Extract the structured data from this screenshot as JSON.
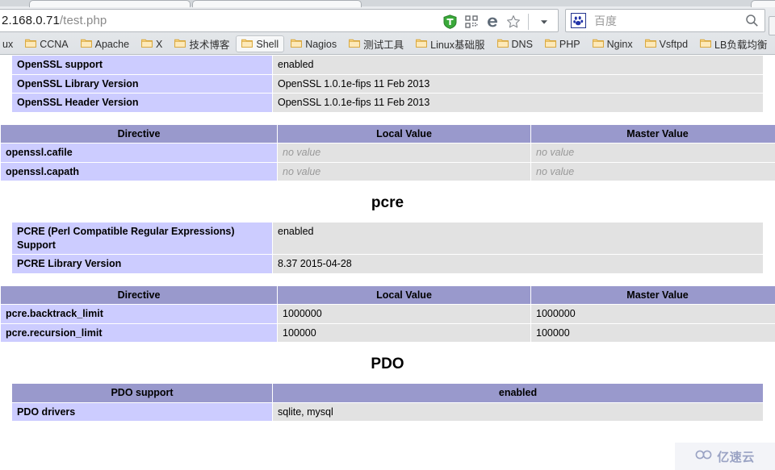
{
  "browser": {
    "url_host": "2.168.0.71",
    "url_path": "/test.php",
    "icons": {
      "shield": "shield-icon",
      "qrcode": "qrcode-icon",
      "ie_mode": "ie-compatibility-icon",
      "favorite": "star-icon",
      "dropdown": "chevron-down-icon",
      "search_submit": "search-icon",
      "baidu": "baidu-paw-icon"
    },
    "search": {
      "placeholder": "百度"
    },
    "bookmarks": [
      {
        "label": "ux",
        "active": false,
        "clipped": true
      },
      {
        "label": "CCNA",
        "active": false
      },
      {
        "label": "Apache",
        "active": false
      },
      {
        "label": "X",
        "active": false
      },
      {
        "label": "技术博客",
        "active": false
      },
      {
        "label": "Shell",
        "active": true
      },
      {
        "label": "Nagios",
        "active": false
      },
      {
        "label": "测试工具",
        "active": false
      },
      {
        "label": "Linux基础服",
        "active": false
      },
      {
        "label": "DNS",
        "active": false
      },
      {
        "label": "PHP",
        "active": false
      },
      {
        "label": "Nginx",
        "active": false
      },
      {
        "label": "Vsftpd",
        "active": false
      },
      {
        "label": "LB负载均衡",
        "active": false
      },
      {
        "label": "",
        "active": false
      }
    ]
  },
  "page": {
    "openssl_info": {
      "rows": [
        {
          "key": "OpenSSL support",
          "value": "enabled"
        },
        {
          "key": "OpenSSL Library Version",
          "value": "OpenSSL 1.0.1e-fips 11 Feb 2013"
        },
        {
          "key": "OpenSSL Header Version",
          "value": "OpenSSL 1.0.1e-fips 11 Feb 2013"
        }
      ]
    },
    "openssl_directives": {
      "headers": [
        "Directive",
        "Local Value",
        "Master Value"
      ],
      "rows": [
        {
          "directive": "openssl.cafile",
          "local": "no value",
          "master": "no value",
          "novalue": true
        },
        {
          "directive": "openssl.capath",
          "local": "no value",
          "master": "no value",
          "novalue": true
        }
      ]
    },
    "pcre_heading": "pcre",
    "pcre_info": {
      "rows": [
        {
          "key": "PCRE (Perl Compatible Regular Expressions) Support",
          "value": "enabled"
        },
        {
          "key": "PCRE Library Version",
          "value": "8.37 2015-04-28"
        }
      ]
    },
    "pcre_directives": {
      "headers": [
        "Directive",
        "Local Value",
        "Master Value"
      ],
      "rows": [
        {
          "directive": "pcre.backtrack_limit",
          "local": "1000000",
          "master": "1000000",
          "novalue": false
        },
        {
          "directive": "pcre.recursion_limit",
          "local": "100000",
          "master": "100000",
          "novalue": false
        }
      ]
    },
    "pdo_heading": "PDO",
    "pdo_info": {
      "header_left": "PDO support",
      "header_right": "enabled",
      "rows": [
        {
          "key": "PDO drivers",
          "value": "sqlite, mysql"
        }
      ]
    }
  },
  "watermark": {
    "text": "亿速云"
  },
  "colors": {
    "table_header": "#9999cc",
    "table_key": "#ccccff",
    "table_value": "#e2e2e2",
    "no_value_text": "#999999"
  }
}
